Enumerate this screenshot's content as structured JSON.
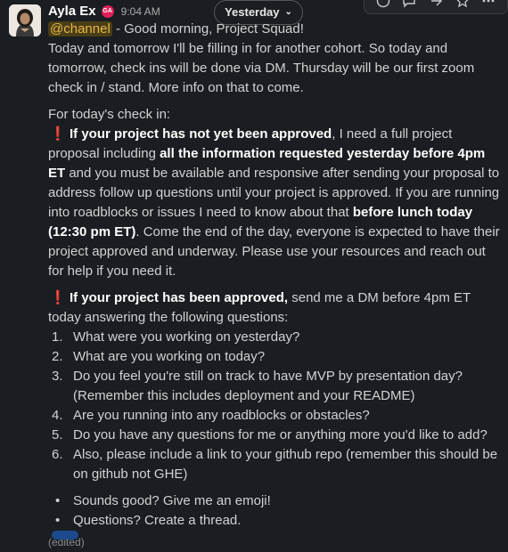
{
  "header": {
    "author": "Ayla Ex",
    "status_badge": "GA",
    "time": "9:04 AM"
  },
  "date_pill": {
    "label": "Yesterday"
  },
  "toolbar": {
    "icons": [
      "reaction-icon",
      "comment-icon",
      "forward-icon",
      "bookmark-icon",
      "more-icon"
    ]
  },
  "message": {
    "mention": "@channel",
    "greeting": " - Good morning, Project Squad!",
    "intro": "Today and tomorrow I'll be filling in for another cohort. So today and tomorrow, check ins will be done via DM. Thursday will be our first zoom check in / stand. More info on that to come.",
    "checkin_header": "For today's check in:",
    "p1": {
      "bold1": "If your project has not yet been approved",
      "t1": ", I need a full project proposal including ",
      "bold2": "all the information requested yesterday before 4pm ET",
      "t2": " and you must be available and responsive after sending your proposal to address follow up questions until your project is approved. If you are running into roadblocks or issues I need to know about that ",
      "bold3": "before lunch today (12:30 pm ET)",
      "t3": ". Come the end of the day, everyone is expected to have their project approved and underway. Please use your resources and reach out for help if you need it."
    },
    "p2": {
      "bold1": "If your project has been approved,",
      "t1": " send me a DM before 4pm ET today answering the following questions:"
    },
    "questions": [
      {
        "num": "1.",
        "text": "What were you working on yesterday?"
      },
      {
        "num": "2.",
        "text": "What are you working on today?"
      },
      {
        "num": "3.",
        "text": "Do you feel you're still on track to have MVP by presentation day? (Remember this includes deployment and your README)"
      },
      {
        "num": "4.",
        "text": "Are you running into any roadblocks or obstacles?"
      },
      {
        "num": "5.",
        "text": "Do you have any questions for me or anything more you'd like to add?"
      },
      {
        "num": "6.",
        "text": "Also, please include a link to your github repo (remember this should be on github not GHE)"
      }
    ],
    "bullets": [
      {
        "symbol": "•",
        "text": "Sounds good? Give me an emoji!"
      },
      {
        "symbol": "•",
        "text": "Questions? Create a thread."
      }
    ],
    "edited": "(edited)"
  },
  "colors": {
    "background": "#1a1d21",
    "text": "#d1d2d3",
    "mention_bg": "#4a3e16",
    "mention_fg": "#e8b74a",
    "exclamation": "#e01e1e"
  }
}
